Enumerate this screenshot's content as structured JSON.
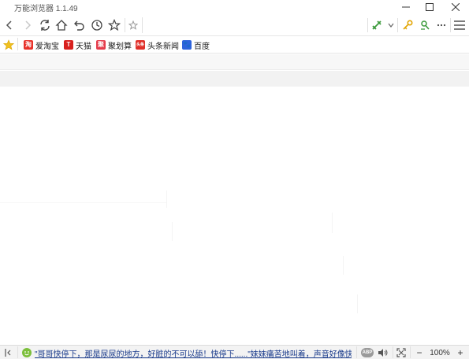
{
  "window": {
    "title": "万能浏览器 1.1.49"
  },
  "navbar": {
    "address_value": ""
  },
  "bookmarks": [
    {
      "label": "爱淘宝",
      "icon": "taobao-icon",
      "glyph": "淘",
      "color": "#e8322a"
    },
    {
      "label": "天猫",
      "icon": "tmall-icon",
      "glyph": "T",
      "color": "#d8201e"
    },
    {
      "label": "聚划算",
      "icon": "juhuasuan-icon",
      "glyph": "聚",
      "color": "#e53c4c"
    },
    {
      "label": "头条新闻",
      "icon": "toutiao-icon",
      "glyph": "头条",
      "color": "#e0302a"
    },
    {
      "label": "百度",
      "icon": "baidu-icon",
      "glyph": "🐾",
      "color": "#2e63dc"
    }
  ],
  "statusbar": {
    "news_text": "\"哥哥快停下，那是尿尿的地方，好脏的不可以舔！快停下......\"妹妹痛苦地叫着，声音好像快要哭出来...",
    "adblock_label": "ABP",
    "zoom_minus": "−",
    "zoom_level": "100%",
    "zoom_plus": "+"
  },
  "colors": {
    "accent_green": "#3b9a3b",
    "key_orange": "#e2a400",
    "link_blue": "#1a3b8c"
  }
}
